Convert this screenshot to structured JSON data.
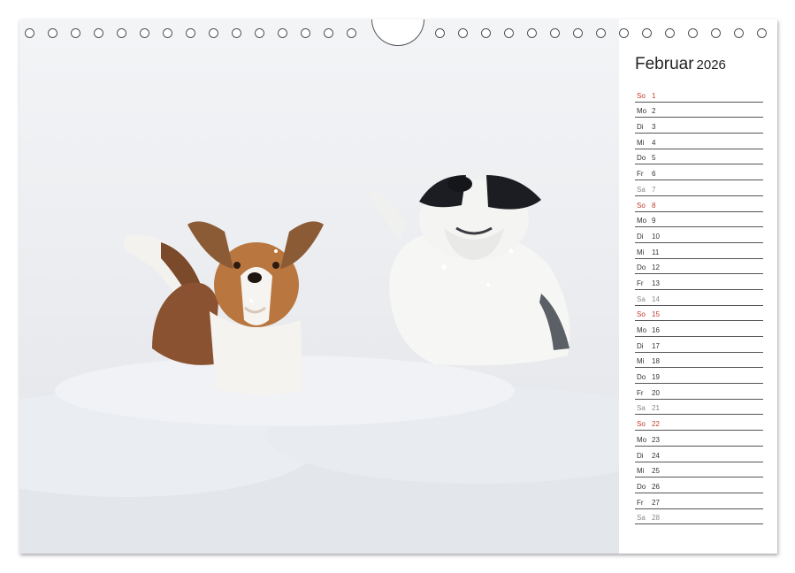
{
  "calendar": {
    "month": "Februar",
    "year": "2026",
    "days": [
      {
        "wd": "So",
        "num": "1",
        "type": "sunday"
      },
      {
        "wd": "Mo",
        "num": "2",
        "type": "weekday"
      },
      {
        "wd": "Di",
        "num": "3",
        "type": "weekday"
      },
      {
        "wd": "Mi",
        "num": "4",
        "type": "weekday"
      },
      {
        "wd": "Do",
        "num": "5",
        "type": "weekday"
      },
      {
        "wd": "Fr",
        "num": "6",
        "type": "weekday"
      },
      {
        "wd": "Sa",
        "num": "7",
        "type": "saturday"
      },
      {
        "wd": "So",
        "num": "8",
        "type": "sunday"
      },
      {
        "wd": "Mo",
        "num": "9",
        "type": "weekday"
      },
      {
        "wd": "Di",
        "num": "10",
        "type": "weekday"
      },
      {
        "wd": "Mi",
        "num": "11",
        "type": "weekday"
      },
      {
        "wd": "Do",
        "num": "12",
        "type": "weekday"
      },
      {
        "wd": "Fr",
        "num": "13",
        "type": "weekday"
      },
      {
        "wd": "Sa",
        "num": "14",
        "type": "saturday"
      },
      {
        "wd": "So",
        "num": "15",
        "type": "sunday"
      },
      {
        "wd": "Mo",
        "num": "16",
        "type": "weekday"
      },
      {
        "wd": "Di",
        "num": "17",
        "type": "weekday"
      },
      {
        "wd": "Mi",
        "num": "18",
        "type": "weekday"
      },
      {
        "wd": "Do",
        "num": "19",
        "type": "weekday"
      },
      {
        "wd": "Fr",
        "num": "20",
        "type": "weekday"
      },
      {
        "wd": "Sa",
        "num": "21",
        "type": "saturday"
      },
      {
        "wd": "So",
        "num": "22",
        "type": "sunday"
      },
      {
        "wd": "Mo",
        "num": "23",
        "type": "weekday"
      },
      {
        "wd": "Di",
        "num": "24",
        "type": "weekday"
      },
      {
        "wd": "Mi",
        "num": "25",
        "type": "weekday"
      },
      {
        "wd": "Do",
        "num": "26",
        "type": "weekday"
      },
      {
        "wd": "Fr",
        "num": "27",
        "type": "weekday"
      },
      {
        "wd": "Sa",
        "num": "28",
        "type": "saturday"
      }
    ]
  },
  "colors": {
    "sunday": "#c0392b",
    "saturday": "#8a8a8a",
    "text": "#333333",
    "rule": "#555555"
  },
  "photo": {
    "subject_icon": "dogs-in-snow-photo"
  }
}
